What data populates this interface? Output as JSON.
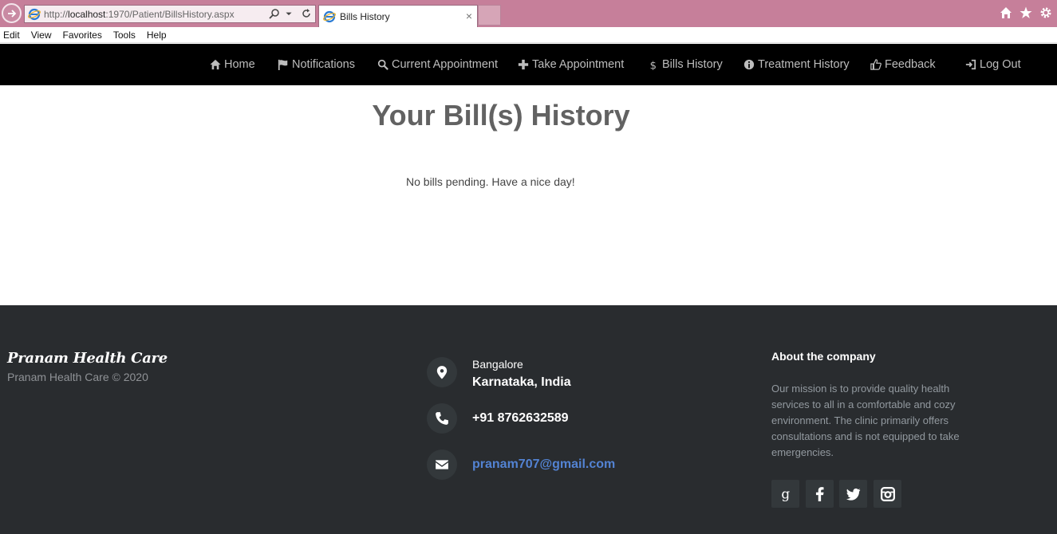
{
  "browser": {
    "url_prefix": "http://",
    "url_host": "localhost",
    "url_rest": ":1970/Patient/BillsHistory.aspx",
    "tab_title": "Bills History",
    "tab_close": "×"
  },
  "menubar": [
    "Edit",
    "View",
    "Favorites",
    "Tools",
    "Help"
  ],
  "navbar": {
    "items": [
      {
        "label": "Home",
        "icon": "home-icon"
      },
      {
        "label": "Notifications",
        "icon": "flag-icon"
      },
      {
        "label": "Current Appointment",
        "icon": "search-icon"
      },
      {
        "label": "Take Appointment",
        "icon": "plus-icon"
      },
      {
        "label": "Bills History",
        "icon": "dollar-icon"
      },
      {
        "label": "Treatment History",
        "icon": "info-icon"
      },
      {
        "label": "Feedback",
        "icon": "thumbs-up-icon"
      },
      {
        "label": "Log Out",
        "icon": "log-out-icon"
      }
    ]
  },
  "main": {
    "title": "Your Bill(s) History",
    "message": "No bills pending. Have a nice day!"
  },
  "footer": {
    "brand": "Pranam Health Care",
    "copyright": "Pranam Health Care © 2020",
    "contact": {
      "city": "Bangalore",
      "region": "Karnataka, India",
      "phone": "+91 8762632589",
      "email": "pranam707@gmail.com"
    },
    "about": {
      "title": "About the company",
      "text": "Our mission is to provide quality health services to all in a comfortable and cozy environment. The clinic primarily offers consultations and is not equipped to take emergencies."
    },
    "social": [
      "google-icon",
      "facebook-icon",
      "twitter-icon",
      "instagram-icon"
    ]
  },
  "colors": {
    "chrome": "#c67f9a",
    "navbar": "#000000",
    "footer": "#292c2f",
    "title": "#626262",
    "email_link": "#5383d3"
  }
}
